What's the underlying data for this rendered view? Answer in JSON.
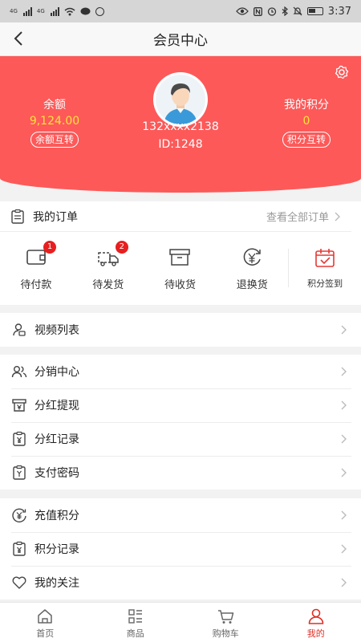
{
  "status_bar": {
    "net1": "4G",
    "net2": "4G",
    "time": "3:37"
  },
  "nav": {
    "title": "会员中心"
  },
  "profile": {
    "balance_label": "余额",
    "balance_value": "9,124.00",
    "balance_action": "余额互转",
    "points_label": "我的积分",
    "points_value": "0",
    "points_action": "积分互转",
    "phone": "132xxxx2138",
    "id_text": "ID:1248"
  },
  "orders": {
    "title": "我的订单",
    "view_all": "查看全部订单",
    "items": [
      {
        "label": "待付款",
        "icon": "wallet-icon",
        "badge": "1"
      },
      {
        "label": "待发货",
        "icon": "truck-icon",
        "badge": "2"
      },
      {
        "label": "待收货",
        "icon": "box-icon"
      },
      {
        "label": "退换货",
        "icon": "refund-icon"
      }
    ],
    "checkin": {
      "label": "积分签到",
      "icon": "calendar-check-icon"
    }
  },
  "menu_groups": [
    [
      {
        "label": "视频列表",
        "icon": "video-user-icon"
      }
    ],
    [
      {
        "label": "分销中心",
        "icon": "users-icon"
      },
      {
        "label": "分红提现",
        "icon": "cash-withdraw-icon"
      },
      {
        "label": "分红记录",
        "icon": "clipboard-yen-icon"
      },
      {
        "label": "支付密码",
        "icon": "clipboard-icon"
      }
    ],
    [
      {
        "label": "充值积分",
        "icon": "yen-circle-icon"
      },
      {
        "label": "积分记录",
        "icon": "clipboard-yen-icon"
      },
      {
        "label": "我的关注",
        "icon": "heart-icon"
      }
    ]
  ],
  "tabbar": [
    {
      "label": "首页",
      "icon": "home-icon",
      "active": false
    },
    {
      "label": "商品",
      "icon": "grid-list-icon",
      "active": false
    },
    {
      "label": "购物车",
      "icon": "cart-icon",
      "active": false
    },
    {
      "label": "我的",
      "icon": "user-icon",
      "active": true
    }
  ],
  "colors": {
    "header_bg": "#fd5959",
    "value_yellow": "#ffe23a",
    "active_red": "#e02e24",
    "badge_red": "#e71f1f"
  }
}
